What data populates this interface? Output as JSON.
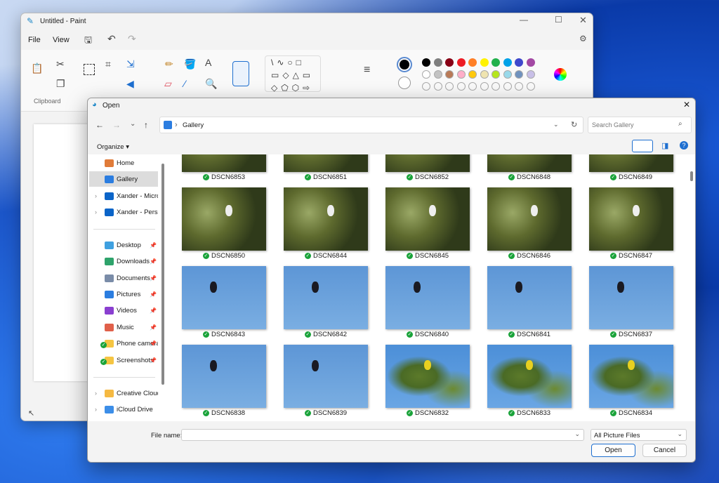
{
  "paint": {
    "title": "Untitled - Paint",
    "menu": [
      "File",
      "View"
    ],
    "clipboard_label": "Clipboard",
    "colors_row1": [
      "#000000",
      "#7f7f7f",
      "#880015",
      "#ed1c24",
      "#ff7f27",
      "#fff200",
      "#22b14c",
      "#00a2e8",
      "#3f48cc",
      "#a349a4"
    ],
    "colors_row2": [
      "#ffffff",
      "#c3c3c3",
      "#b97a57",
      "#ffaec9",
      "#ffc90e",
      "#efe4b0",
      "#b5e61d",
      "#99d9ea",
      "#7092be",
      "#c8bfe7"
    ],
    "primary_color": "#000000",
    "secondary_color": "#ffffff"
  },
  "dialog": {
    "title": "Open",
    "breadcrumb": "Gallery",
    "search_placeholder": "Search Gallery",
    "organize": "Organize",
    "sidebar": [
      {
        "label": "Home",
        "icon": "home-icon",
        "color": "#e07b39"
      },
      {
        "label": "Gallery",
        "icon": "gallery-icon",
        "color": "#2b7de0",
        "selected": true
      },
      {
        "label": "Xander - Microsoft",
        "icon": "onedrive-icon",
        "color": "#0a64c8",
        "expand": true
      },
      {
        "label": "Xander - Personal",
        "icon": "onedrive-icon",
        "color": "#0a64c8",
        "expand": true
      },
      {
        "label": "Desktop",
        "icon": "desktop-icon",
        "color": "#3fa0e0",
        "pin": true
      },
      {
        "label": "Downloads",
        "icon": "download-icon",
        "color": "#2ea36b",
        "pin": true
      },
      {
        "label": "Documents",
        "icon": "documents-icon",
        "color": "#7a8ca8",
        "pin": true
      },
      {
        "label": "Pictures",
        "icon": "pictures-icon",
        "color": "#2b7de0",
        "pin": true
      },
      {
        "label": "Videos",
        "icon": "videos-icon",
        "color": "#8a3fd0",
        "pin": true
      },
      {
        "label": "Music",
        "icon": "music-icon",
        "color": "#e0604a",
        "pin": true
      },
      {
        "label": "Phone camera",
        "icon": "folder-icon",
        "color": "#f5c542",
        "pin": true,
        "synced": true
      },
      {
        "label": "Screenshots",
        "icon": "folder-icon",
        "color": "#f5c542",
        "pin": true,
        "synced": true
      },
      {
        "label": "Creative Cloud Files",
        "icon": "creative-cloud-icon",
        "color": "#f5b942",
        "expand": true
      },
      {
        "label": "iCloud Drive",
        "icon": "icloud-icon",
        "color": "#3c8ee8",
        "expand": true
      }
    ],
    "files": [
      {
        "name": "DSCN6853",
        "style": "green"
      },
      {
        "name": "DSCN6851",
        "style": "green"
      },
      {
        "name": "DSCN6852",
        "style": "green"
      },
      {
        "name": "DSCN6848",
        "style": "green"
      },
      {
        "name": "DSCN6849",
        "style": "green"
      },
      {
        "name": "DSCN6850",
        "style": "green"
      },
      {
        "name": "DSCN6844",
        "style": "green"
      },
      {
        "name": "DSCN6845",
        "style": "green"
      },
      {
        "name": "DSCN6846",
        "style": "green"
      },
      {
        "name": "DSCN6847",
        "style": "green"
      },
      {
        "name": "DSCN6843",
        "style": "blue"
      },
      {
        "name": "DSCN6842",
        "style": "blue"
      },
      {
        "name": "DSCN6840",
        "style": "blue"
      },
      {
        "name": "DSCN6841",
        "style": "blue"
      },
      {
        "name": "DSCN6837",
        "style": "blue"
      },
      {
        "name": "DSCN6838",
        "style": "blue"
      },
      {
        "name": "DSCN6839",
        "style": "blue"
      },
      {
        "name": "DSCN6832",
        "style": "tree"
      },
      {
        "name": "DSCN6833",
        "style": "tree"
      },
      {
        "name": "DSCN6834",
        "style": "tree"
      }
    ],
    "file_name_label": "File name:",
    "file_name_value": "",
    "file_type": "All Picture Files",
    "open": "Open",
    "cancel": "Cancel"
  }
}
